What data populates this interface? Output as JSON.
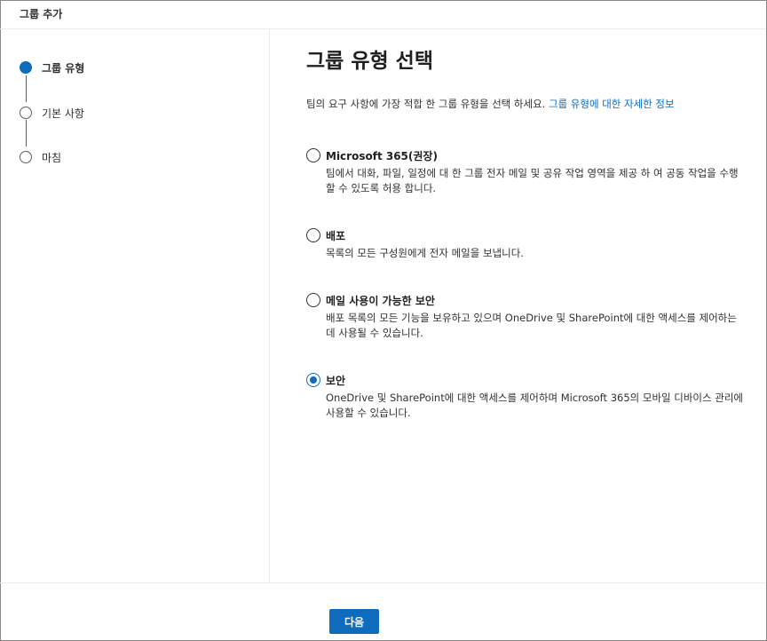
{
  "dialog": {
    "title": "그룹 추가"
  },
  "steps": [
    {
      "label": "그룹 유형",
      "active": true
    },
    {
      "label": "기본 사항",
      "active": false
    },
    {
      "label": "마침",
      "active": false
    }
  ],
  "main": {
    "title": "그룹 유형 선택",
    "intro_text": "팀의 요구 사항에 가장 적합 한 그룹 유형을 선택 하세요.",
    "intro_link": "그룹 유형에 대한 자세한 정보",
    "options": [
      {
        "title": "Microsoft 365(권장)",
        "description": "팀에서 대화, 파일, 일정에 대 한 그룹 전자 메일 및 공유 작업 영역을 제공 하 여 공동 작업을 수행할 수 있도록 허용 합니다.",
        "selected": false
      },
      {
        "title": "배포",
        "description": "목록의 모든 구성원에게 전자 메일을 보냅니다.",
        "selected": false
      },
      {
        "title": "메일 사용이 가능한 보안",
        "description": "배포 목록의 모든 기능을 보유하고 있으며 OneDrive 및 SharePoint에 대한 액세스를 제어하는 데 사용될 수 있습니다.",
        "selected": false
      },
      {
        "title": "보안",
        "description": "OneDrive 및 SharePoint에 대한 액세스를 제어하며 Microsoft 365의 모바일 디바이스 관리에 사용할 수 있습니다.",
        "selected": true
      }
    ]
  },
  "footer": {
    "next_label": "다음"
  },
  "colors": {
    "accent": "#0f6cbd",
    "text": "#323130",
    "border": "#edebe9"
  }
}
